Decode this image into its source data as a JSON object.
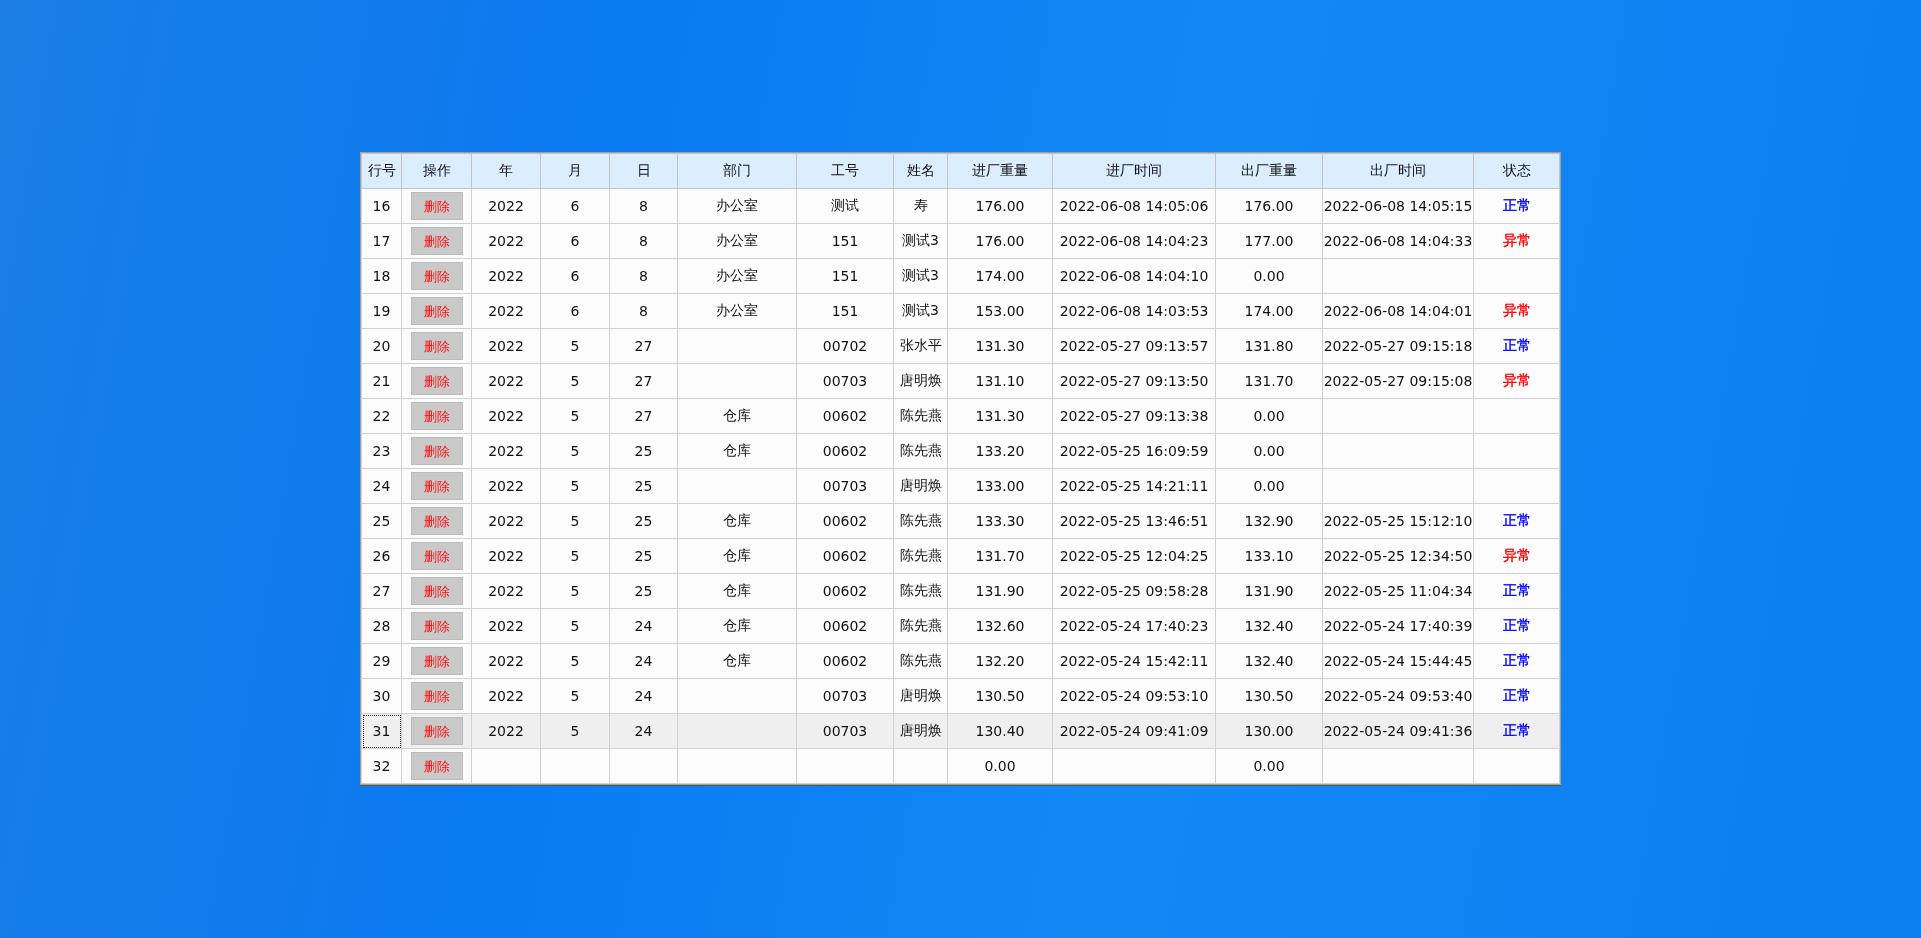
{
  "table": {
    "columns": [
      "行号",
      "操作",
      "年",
      "月",
      "日",
      "部门",
      "工号",
      "姓名",
      "进厂重量",
      "进厂时间",
      "出厂重量",
      "出厂时间",
      "状态"
    ],
    "rows": [
      {
        "row_no": "16",
        "action": "删除",
        "year": "2022",
        "month": "6",
        "day": "8",
        "department": "办公室",
        "employee_no": "测试",
        "name": "寿",
        "in_weight": "176.00",
        "in_time": "2022-06-08 14:05:06",
        "out_weight": "176.00",
        "out_time": "2022-06-08 14:05:15",
        "status": {
          "text": "正常",
          "color": "#0000ff"
        },
        "selected": false
      },
      {
        "row_no": "17",
        "action": "删除",
        "year": "2022",
        "month": "6",
        "day": "8",
        "department": "办公室",
        "employee_no": "151",
        "name": "测试3",
        "in_weight": "176.00",
        "in_time": "2022-06-08 14:04:23",
        "out_weight": "177.00",
        "out_time": "2022-06-08 14:04:33",
        "status": {
          "text": "异常",
          "color": "#ff0000"
        },
        "selected": false
      },
      {
        "row_no": "18",
        "action": "删除",
        "year": "2022",
        "month": "6",
        "day": "8",
        "department": "办公室",
        "employee_no": "151",
        "name": "测试3",
        "in_weight": "174.00",
        "in_time": "2022-06-08 14:04:10",
        "out_weight": "0.00",
        "selected": false
      },
      {
        "row_no": "19",
        "action": "删除",
        "year": "2022",
        "month": "6",
        "day": "8",
        "department": "办公室",
        "employee_no": "151",
        "name": "测试3",
        "in_weight": "153.00",
        "in_time": "2022-06-08 14:03:53",
        "out_weight": "174.00",
        "out_time": "2022-06-08 14:04:01",
        "status": {
          "text": "异常",
          "color": "#ff0000"
        },
        "selected": false
      },
      {
        "row_no": "20",
        "action": "删除",
        "year": "2022",
        "month": "5",
        "day": "27",
        "employee_no": "00702",
        "name": "张水平",
        "in_weight": "131.30",
        "in_time": "2022-05-27 09:13:57",
        "out_weight": "131.80",
        "out_time": "2022-05-27 09:15:18",
        "status": {
          "text": "正常",
          "color": "#0000ff"
        },
        "selected": false
      },
      {
        "row_no": "21",
        "action": "删除",
        "year": "2022",
        "month": "5",
        "day": "27",
        "employee_no": "00703",
        "name": "唐明焕",
        "in_weight": "131.10",
        "in_time": "2022-05-27 09:13:50",
        "out_weight": "131.70",
        "out_time": "2022-05-27 09:15:08",
        "status": {
          "text": "异常",
          "color": "#ff0000"
        },
        "selected": false
      },
      {
        "row_no": "22",
        "action": "删除",
        "year": "2022",
        "month": "5",
        "day": "27",
        "department": "仓库",
        "employee_no": "00602",
        "name": "陈先燕",
        "in_weight": "131.30",
        "in_time": "2022-05-27 09:13:38",
        "out_weight": "0.00",
        "selected": false
      },
      {
        "row_no": "23",
        "action": "删除",
        "year": "2022",
        "month": "5",
        "day": "25",
        "department": "仓库",
        "employee_no": "00602",
        "name": "陈先燕",
        "in_weight": "133.20",
        "in_time": "2022-05-25 16:09:59",
        "out_weight": "0.00",
        "selected": false
      },
      {
        "row_no": "24",
        "action": "删除",
        "year": "2022",
        "month": "5",
        "day": "25",
        "employee_no": "00703",
        "name": "唐明焕",
        "in_weight": "133.00",
        "in_time": "2022-05-25 14:21:11",
        "out_weight": "0.00",
        "selected": false
      },
      {
        "row_no": "25",
        "action": "删除",
        "year": "2022",
        "month": "5",
        "day": "25",
        "department": "仓库",
        "employee_no": "00602",
        "name": "陈先燕",
        "in_weight": "133.30",
        "in_time": "2022-05-25 13:46:51",
        "out_weight": "132.90",
        "out_time": "2022-05-25 15:12:10",
        "status": {
          "text": "正常",
          "color": "#0000ff"
        },
        "selected": false
      },
      {
        "row_no": "26",
        "action": "删除",
        "year": "2022",
        "month": "5",
        "day": "25",
        "department": "仓库",
        "employee_no": "00602",
        "name": "陈先燕",
        "in_weight": "131.70",
        "in_time": "2022-05-25 12:04:25",
        "out_weight": "133.10",
        "out_time": "2022-05-25 12:34:50",
        "status": {
          "text": "异常",
          "color": "#ff0000"
        },
        "selected": false
      },
      {
        "row_no": "27",
        "action": "删除",
        "year": "2022",
        "month": "5",
        "day": "25",
        "department": "仓库",
        "employee_no": "00602",
        "name": "陈先燕",
        "in_weight": "131.90",
        "in_time": "2022-05-25 09:58:28",
        "out_weight": "131.90",
        "out_time": "2022-05-25 11:04:34",
        "status": {
          "text": "正常",
          "color": "#0000ff"
        },
        "selected": false
      },
      {
        "row_no": "28",
        "action": "删除",
        "year": "2022",
        "month": "5",
        "day": "24",
        "department": "仓库",
        "employee_no": "00602",
        "name": "陈先燕",
        "in_weight": "132.60",
        "in_time": "2022-05-24 17:40:23",
        "out_weight": "132.40",
        "out_time": "2022-05-24 17:40:39",
        "status": {
          "text": "正常",
          "color": "#0000ff"
        },
        "selected": false
      },
      {
        "row_no": "29",
        "action": "删除",
        "year": "2022",
        "month": "5",
        "day": "24",
        "department": "仓库",
        "employee_no": "00602",
        "name": "陈先燕",
        "in_weight": "132.20",
        "in_time": "2022-05-24 15:42:11",
        "out_weight": "132.40",
        "out_time": "2022-05-24 15:44:45",
        "status": {
          "text": "正常",
          "color": "#0000ff"
        },
        "selected": false
      },
      {
        "row_no": "30",
        "action": "删除",
        "year": "2022",
        "month": "5",
        "day": "24",
        "employee_no": "00703",
        "name": "唐明焕",
        "in_weight": "130.50",
        "in_time": "2022-05-24 09:53:10",
        "out_weight": "130.50",
        "out_time": "2022-05-24 09:53:40",
        "status": {
          "text": "正常",
          "color": "#0000ff"
        },
        "selected": false
      },
      {
        "row_no": "31",
        "action": "删除",
        "year": "2022",
        "month": "5",
        "day": "24",
        "employee_no": "00703",
        "name": "唐明焕",
        "in_weight": "130.40",
        "in_time": "2022-05-24 09:41:09",
        "out_weight": "130.00",
        "out_time": "2022-05-24 09:41:36",
        "status": {
          "text": "正常",
          "color": "#0000ff"
        },
        "selected": true
      },
      {
        "row_no": "32",
        "action": "删除",
        "in_weight": "0.00",
        "out_weight": "0.00",
        "selected": false
      }
    ]
  }
}
